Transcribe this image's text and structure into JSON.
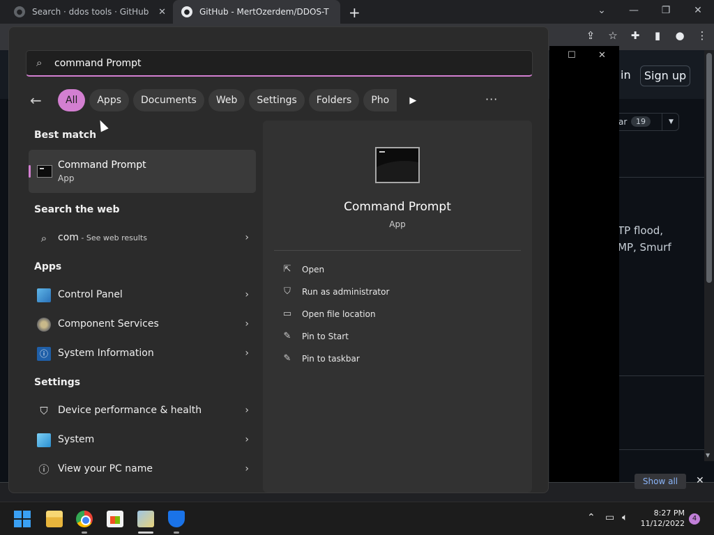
{
  "browser": {
    "tabs": [
      {
        "title": "Search · ddos tools · GitHub"
      },
      {
        "title": "GitHub - MertOzerdem/DDOS-T"
      }
    ],
    "new_tab_symbol": "+",
    "window_controls": [
      "⌄",
      "—",
      "❐",
      "✕"
    ]
  },
  "github": {
    "signin": "in",
    "signup": "Sign up",
    "star_label": "ar",
    "star_count": "19",
    "text_line1": "TP flood,",
    "text_line2": "MP, Smurf"
  },
  "search": {
    "query": "command Prompt",
    "filters": [
      "All",
      "Apps",
      "Documents",
      "Web",
      "Settings",
      "Folders",
      "Pho"
    ],
    "active_filter": "All",
    "more": "···"
  },
  "sections": {
    "best_match": "Best match",
    "search_web": "Search the web",
    "apps": "Apps",
    "settings": "Settings"
  },
  "best_match": {
    "name": "Command Prompt",
    "type": "App"
  },
  "web_result": {
    "query": "com",
    "hint": " - See web results"
  },
  "apps": [
    {
      "label": "Control Panel",
      "icon": "control-panel-icon"
    },
    {
      "label": "Component Services",
      "icon": "component-services-icon"
    },
    {
      "label": "System Information",
      "icon": "system-information-icon"
    }
  ],
  "settings": [
    {
      "label": "Device performance & health",
      "icon": "shield-icon"
    },
    {
      "label": "System",
      "icon": "monitor-icon"
    },
    {
      "label": "View your PC name",
      "icon": "info-icon"
    }
  ],
  "preview": {
    "name": "Command Prompt",
    "type": "App",
    "actions": [
      {
        "label": "Open",
        "icon": "open-external-icon"
      },
      {
        "label": "Run as administrator",
        "icon": "admin-shield-icon"
      },
      {
        "label": "Open file location",
        "icon": "folder-icon"
      },
      {
        "label": "Pin to Start",
        "icon": "pin-icon"
      },
      {
        "label": "Pin to taskbar",
        "icon": "pin-icon"
      }
    ]
  },
  "downloads": {
    "show_all": "Show all"
  },
  "taskbar": {
    "time": "8:27 PM",
    "date": "11/12/2022",
    "notifications": "4"
  },
  "colors": {
    "accent": "#d37fd1",
    "panel": "#2b2b2b"
  }
}
